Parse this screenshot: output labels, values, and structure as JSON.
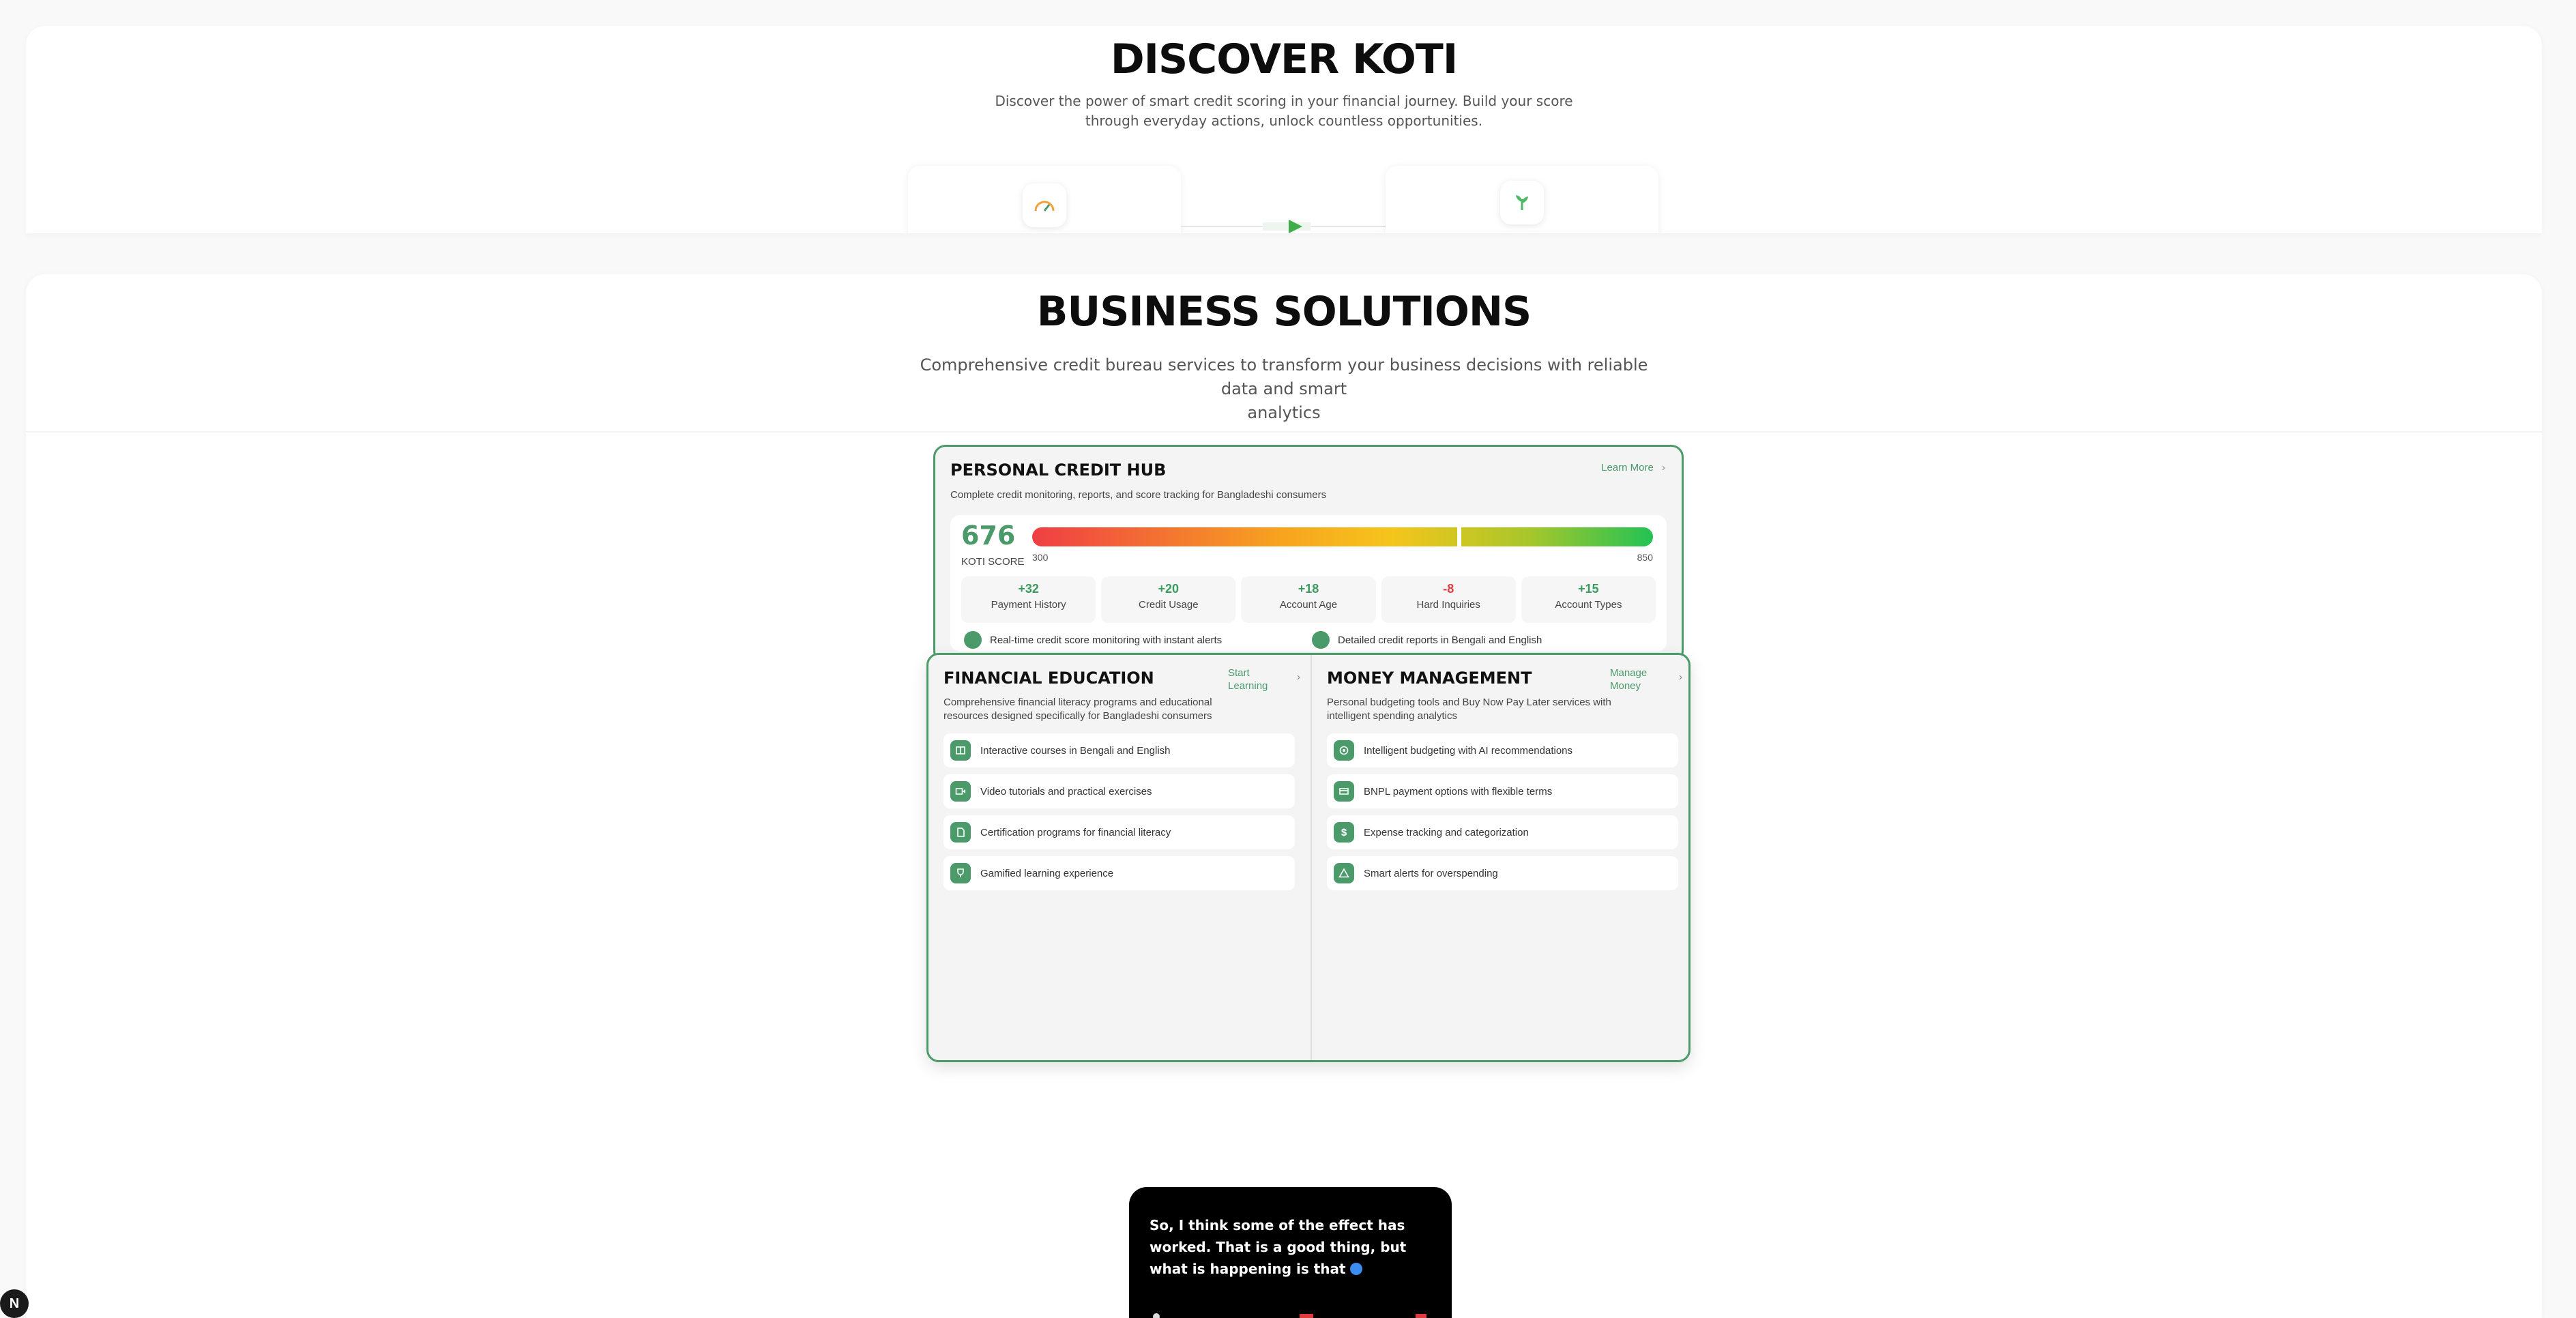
{
  "discover": {
    "title": "DISCOVER KOTI",
    "subtitle_line1": "Discover the power of smart credit scoring in your financial journey. Build your score",
    "subtitle_line2": "through everyday actions, unlock countless opportunities."
  },
  "business": {
    "title": "BUSINESS SOLUTIONS",
    "subtitle_line1": "Comprehensive credit bureau services to transform your business decisions with reliable data and smart",
    "subtitle_line2": "analytics"
  },
  "hub": {
    "title": "PERSONAL CREDIT HUB",
    "description": "Complete credit monitoring, reports, and score tracking for Bangladeshi consumers",
    "learn_more": "Learn More",
    "score": "676",
    "score_label": "KOTI SCORE",
    "range_min": "300",
    "range_max": "850",
    "score_fraction": 0.685,
    "factors": [
      {
        "value": "+32",
        "label": "Payment History",
        "color": "#3c9a5f"
      },
      {
        "value": "+20",
        "label": "Credit Usage",
        "color": "#3c9a5f"
      },
      {
        "value": "+18",
        "label": "Account Age",
        "color": "#3c9a5f"
      },
      {
        "value": "-8",
        "label": "Hard Inquiries",
        "color": "#e0393e"
      },
      {
        "value": "+15",
        "label": "Account Types",
        "color": "#3c9a5f"
      }
    ],
    "features": [
      "Real-time credit score monitoring with instant alerts",
      "Detailed credit reports in Bengali and English"
    ]
  },
  "education": {
    "title": "FINANCIAL EDUCATION",
    "link_line1": "Start",
    "link_line2": "Learning",
    "description": "Comprehensive financial literacy programs and educational resources designed specifically for Bangladeshi consumers",
    "items": [
      {
        "text": "Interactive courses in Bengali and English",
        "icon": "book-icon"
      },
      {
        "text": "Video tutorials and practical exercises",
        "icon": "video-icon"
      },
      {
        "text": "Certification programs for financial literacy",
        "icon": "certificate-icon"
      },
      {
        "text": "Gamified learning experience",
        "icon": "trophy-icon"
      }
    ]
  },
  "money": {
    "title": "MONEY MANAGEMENT",
    "link_line1": "Manage",
    "link_line2": "Money",
    "description": "Personal budgeting tools and Buy Now Pay Later services with intelligent spending analytics",
    "items": [
      {
        "text": "Intelligent budgeting with AI recommendations",
        "icon": "target-icon"
      },
      {
        "text": "BNPL payment options with flexible terms",
        "icon": "card-icon"
      },
      {
        "text": "Expense tracking and categorization",
        "icon": "dollar-icon"
      },
      {
        "text": "Smart alerts for overspending",
        "icon": "warning-icon"
      }
    ]
  },
  "popup": {
    "text": "So, I think some of the effect has worked. That is a good thing, but what is happening is that"
  },
  "badge": {
    "letter": "N"
  },
  "colors": {
    "accent": "#4a9a6a",
    "negative": "#e0393e"
  }
}
